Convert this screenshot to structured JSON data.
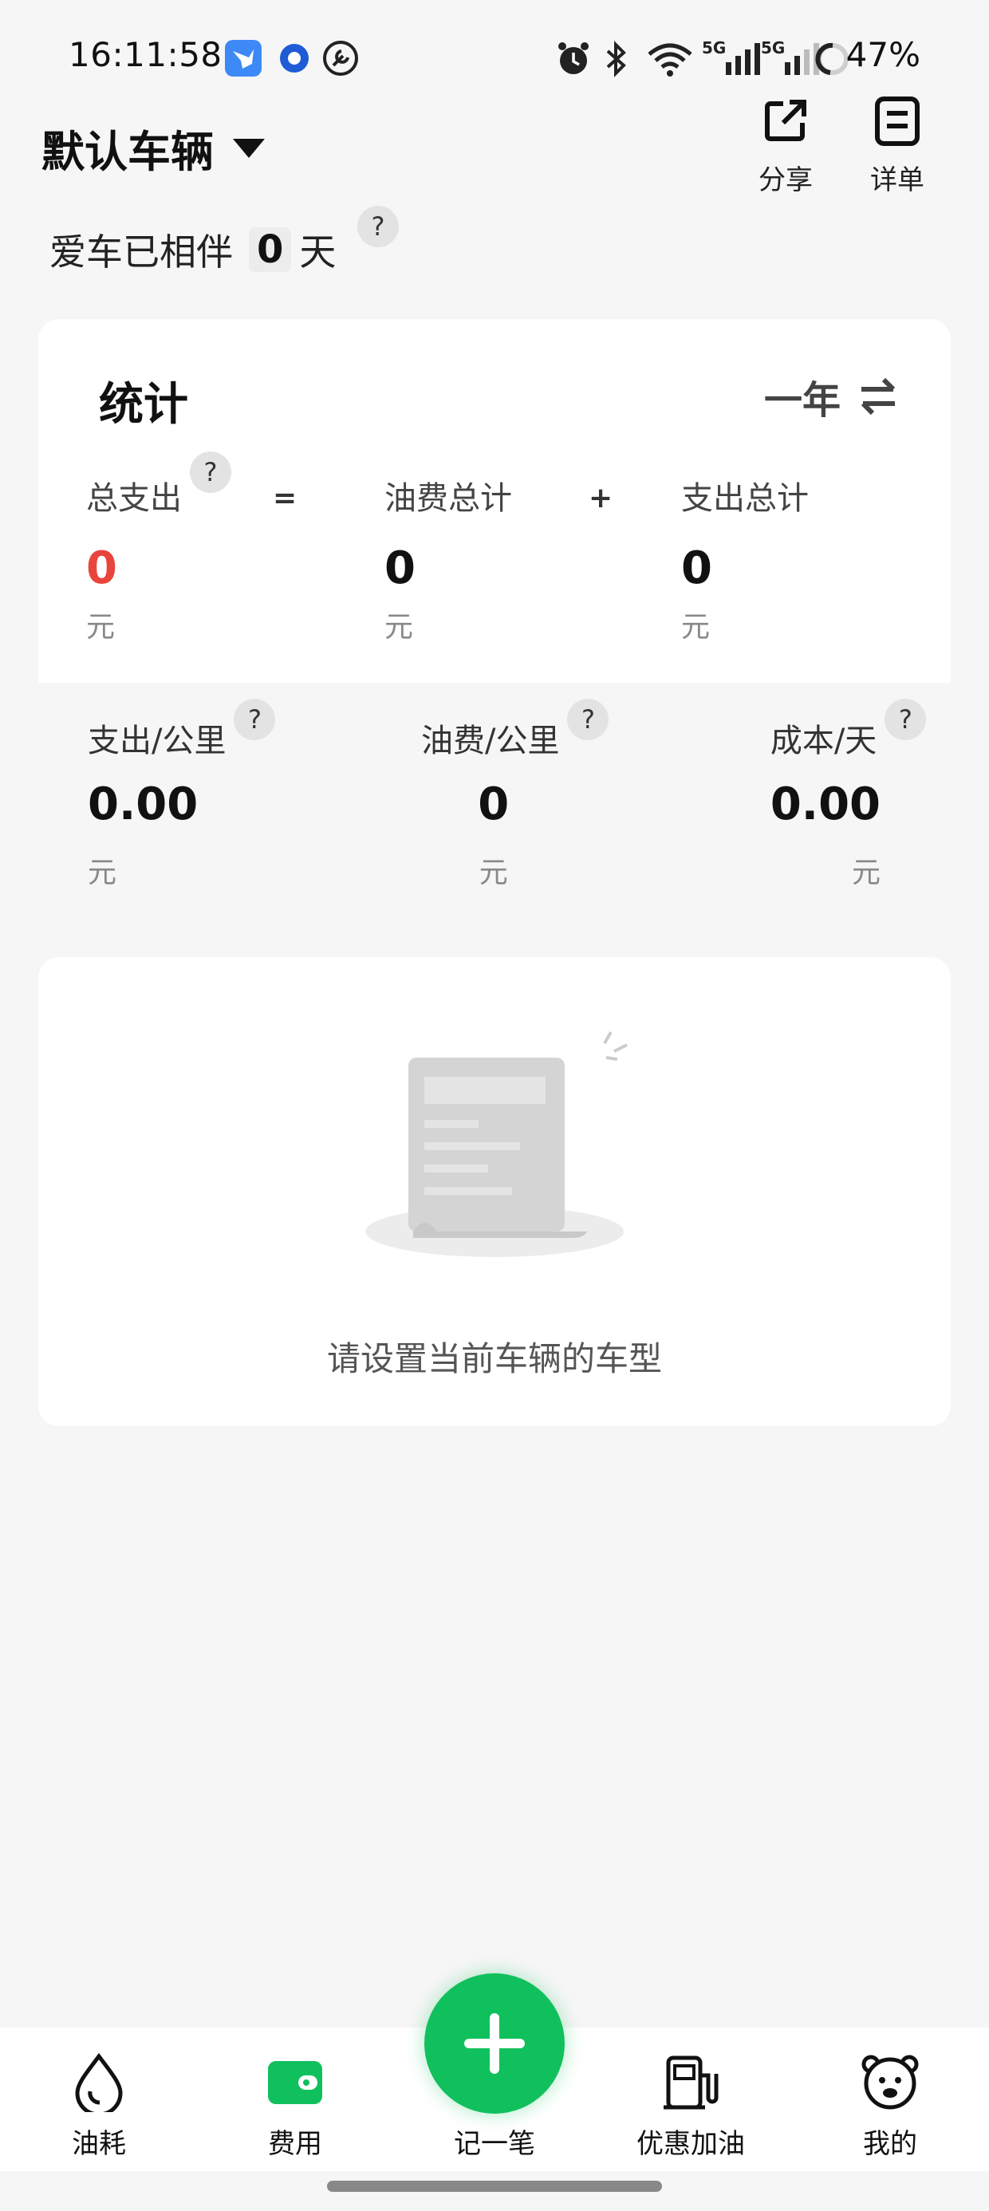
{
  "status_bar": {
    "time": "16:11:58",
    "battery": "47%",
    "network_labels": [
      "5G",
      "5G"
    ]
  },
  "header": {
    "vehicle_name": "默认车辆",
    "share_label": "分享",
    "detail_label": "详单"
  },
  "companion": {
    "prefix": "爱车已相伴",
    "days": "0",
    "suffix": "天",
    "help": "?"
  },
  "stats": {
    "title": "统计",
    "period": "一年",
    "total_expense": {
      "label": "总支出",
      "value": "0",
      "unit": "元"
    },
    "equals": "=",
    "fuel_total": {
      "label": "油费总计",
      "value": "0",
      "unit": "元"
    },
    "plus": "+",
    "expense_total": {
      "label": "支出总计",
      "value": "0",
      "unit": "元"
    },
    "expense_per_km": {
      "label": "支出/公里",
      "value": "0.00",
      "unit": "元"
    },
    "fuel_per_km": {
      "label": "油费/公里",
      "value": "0",
      "unit": "元"
    },
    "cost_per_day": {
      "label": "成本/天",
      "value": "0.00",
      "unit": "元"
    },
    "help": "?"
  },
  "empty_state": {
    "message": "请设置当前车辆的车型"
  },
  "bottom_nav": {
    "items": [
      {
        "label": "油耗",
        "icon": "droplet-icon"
      },
      {
        "label": "费用",
        "icon": "wallet-icon"
      },
      {
        "label": "记一笔",
        "icon": "plus-icon"
      },
      {
        "label": "优惠加油",
        "icon": "fuel-pump-icon"
      },
      {
        "label": "我的",
        "icon": "bear-icon"
      }
    ]
  },
  "colors": {
    "accent_green": "#10c05d",
    "total_red": "#e8453c"
  }
}
